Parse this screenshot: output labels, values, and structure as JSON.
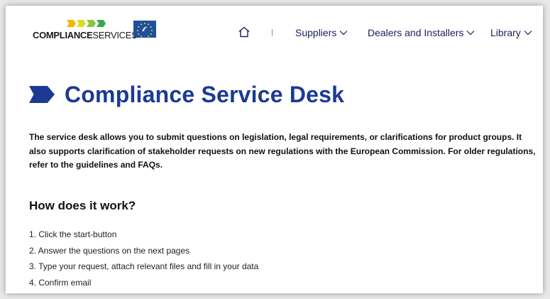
{
  "colors": {
    "brand_blue": "#1c3a94",
    "nav_text": "#1b1f5c",
    "energy_arrows": [
      "#3aa846",
      "#8cc63f",
      "#d7df23",
      "#f2b705"
    ]
  },
  "header": {
    "logo": {
      "bold_text": "COMPLIANCE",
      "light_text": "SERVICES"
    },
    "eu_flag_icon": "eu-life-flag",
    "nav": {
      "home_icon": "home-icon",
      "items": [
        {
          "label": "Suppliers",
          "icon": "chevron-down-icon"
        },
        {
          "label": "Dealers and Installers",
          "icon": "chevron-down-icon"
        },
        {
          "label": "Library",
          "icon": "chevron-down-icon"
        }
      ]
    }
  },
  "main": {
    "title": "Compliance Service Desk",
    "intro": "The service desk allows you to submit questions on legislation, legal requirements, or clarifications for product groups. It also supports clarification of stakeholder requests on new regulations with the European Commission. For older regulations, refer to the guidelines and FAQs.",
    "how_heading": "How does it work?",
    "steps": [
      "1. Click the start-button",
      "2. Answer the questions on the next pages",
      "3. Type your request, attach relevant files and fill in your data",
      "4. Confirm email"
    ]
  }
}
